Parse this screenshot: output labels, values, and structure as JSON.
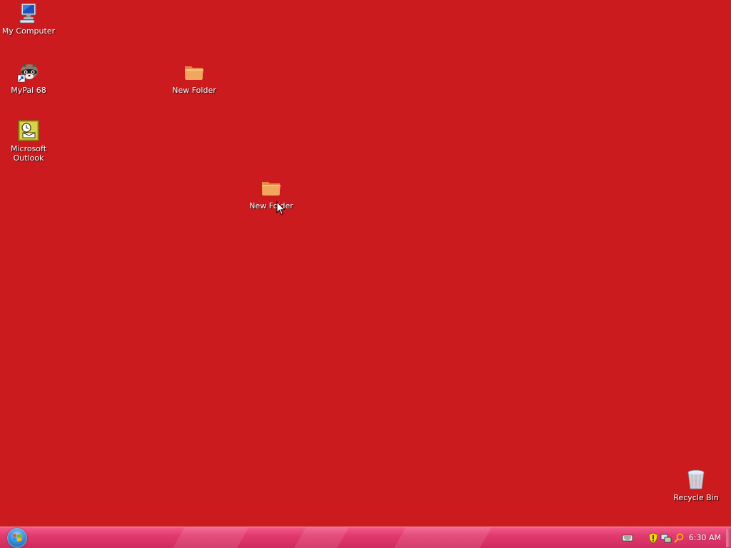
{
  "desktop": {
    "background_color": "#cb1b1e",
    "icons": [
      {
        "label": "My Computer",
        "icon": "computer-icon"
      },
      {
        "label": "MyPal 68",
        "icon": "raccoon-shortcut-icon"
      },
      {
        "label": "Microsoft Outlook",
        "icon": "outlook-icon"
      },
      {
        "label": "New Folder",
        "icon": "folder-icon"
      },
      {
        "label": "New Folder",
        "icon": "folder-icon"
      },
      {
        "label": "Recycle Bin",
        "icon": "recycle-bin-icon"
      }
    ]
  },
  "taskbar": {
    "color": "#e13a6f",
    "start_button": {
      "icon": "windows-orb-icon"
    },
    "tray": {
      "icons": [
        "keyboard-icon",
        "security-shield-icon",
        "network-icon",
        "search-icon"
      ],
      "clock": "6:30 AM"
    }
  }
}
